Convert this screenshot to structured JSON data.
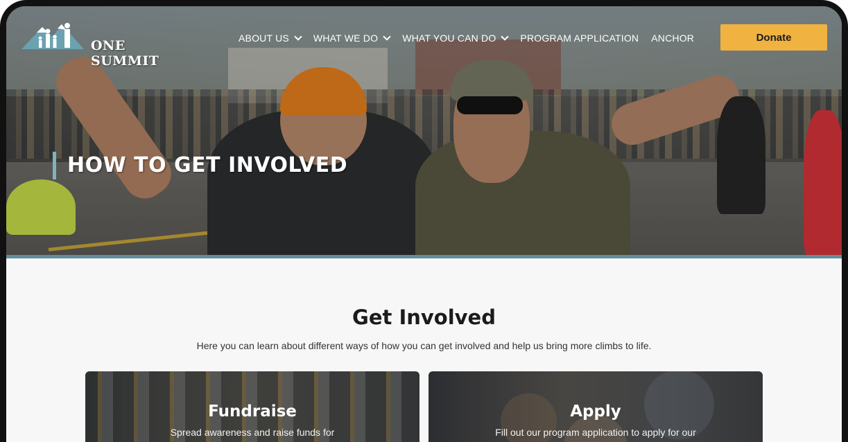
{
  "header": {
    "logo_text": "ONE SUMMIT",
    "nav": [
      {
        "label": "ABOUT US",
        "dropdown": true
      },
      {
        "label": "WHAT WE DO",
        "dropdown": true
      },
      {
        "label": "WHAT YOU CAN DO",
        "dropdown": true
      },
      {
        "label": "PROGRAM APPLICATION",
        "dropdown": false
      },
      {
        "label": "ANCHOR",
        "dropdown": false
      }
    ],
    "donate_label": "Donate"
  },
  "hero": {
    "title": "HOW TO GET INVOLVED"
  },
  "main": {
    "title": "Get Involved",
    "subtitle": "Here you can learn about different ways of how you can get involved and help us bring more climbs to life.",
    "cards": [
      {
        "title": "Fundraise",
        "text": "Spread awareness and raise funds for"
      },
      {
        "title": "Apply",
        "text": "Fill out our program application to apply for our"
      }
    ]
  },
  "colors": {
    "accent": "#f0b240",
    "hero_bar": "#5f8f9a",
    "title_border": "#7fb3bf"
  }
}
